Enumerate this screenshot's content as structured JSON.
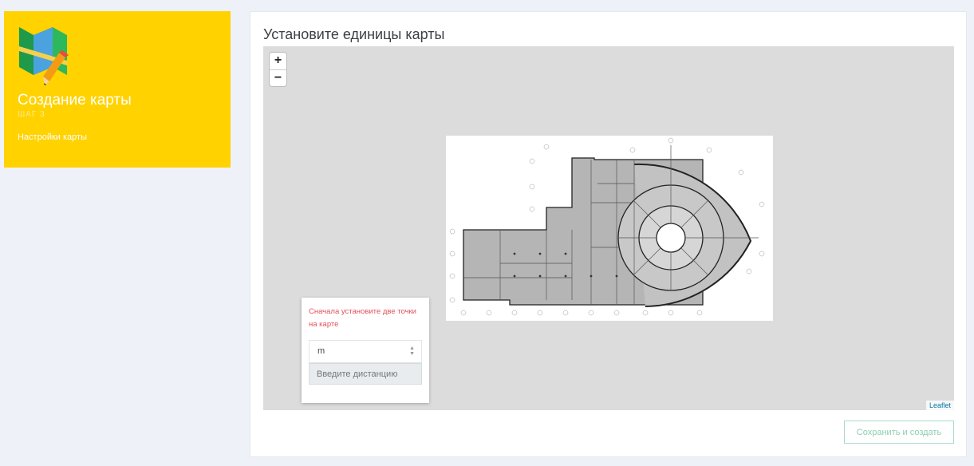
{
  "sidebar": {
    "logo": "map-pencil-icon",
    "title": "Создание карты",
    "step": "ШАГ 3",
    "description": "Настройки карты"
  },
  "main": {
    "title": "Установите единицы карты",
    "map": {
      "zoom_in": "+",
      "zoom_out": "−",
      "attribution": "Leaflet",
      "image": "floor-plan-image"
    },
    "unit_panel": {
      "hint": "Сначала установите две точки на карте",
      "unit_value": "m",
      "distance_placeholder": "Введите дистанцию"
    },
    "save_label": "Сохранить и создать"
  },
  "colors": {
    "sidebar_bg": "#ffd200",
    "page_bg": "#eef2f8",
    "hint_red": "#e0525a",
    "save_green": "#8fcfae"
  }
}
